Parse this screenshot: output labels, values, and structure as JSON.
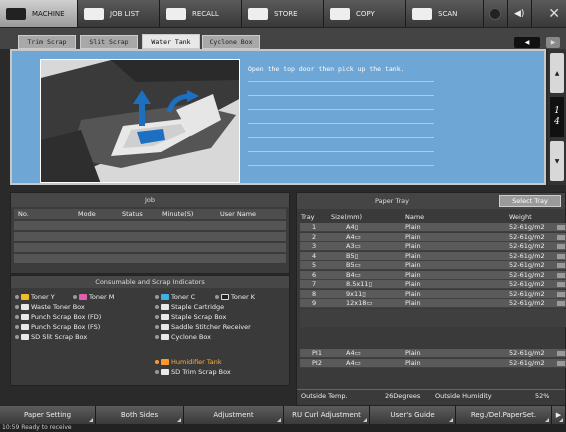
{
  "top_tabs": [
    {
      "label": "MACHINE",
      "icon": "machine-icon"
    },
    {
      "label": "JOB LIST",
      "icon": "job-list-icon"
    },
    {
      "label": "RECALL",
      "icon": "recall-icon"
    },
    {
      "label": "STORE",
      "icon": "store-icon"
    },
    {
      "label": "COPY",
      "icon": "copy-icon"
    },
    {
      "label": "SCAN",
      "icon": "scan-icon"
    }
  ],
  "sub_tabs": [
    "Trim Scrap",
    "Slit Scrap",
    "Water Tank",
    "Cyclone Box"
  ],
  "active_sub_tab": "Water Tank",
  "guide": {
    "instruction": "Open the top door then pick up the tank."
  },
  "page_indicator": {
    "current": "1",
    "total": "4"
  },
  "job": {
    "title": "Job",
    "columns": [
      "No.",
      "Mode",
      "Status",
      "Minute(S)",
      "User Name"
    ]
  },
  "consumables": {
    "title": "Consumable and Scrap Indicators",
    "left": [
      "Toner Y",
      "Toner M",
      "Waste Toner Box",
      "Punch Scrap Box (FD)",
      "Punch Scrap Box (FS)",
      "SD Slit Scrap Box"
    ],
    "right": [
      "Toner C",
      "Toner K",
      "Staple Cartridge",
      "Staple Scrap Box",
      "Saddle Stitcher Receiver",
      "Cyclone Box"
    ],
    "alert": "Humidifier Tank",
    "extra": "SD Trim Scrap Box"
  },
  "paper_tray": {
    "title": "Paper Tray",
    "select_button": "Select Tray",
    "columns": [
      "Tray",
      "Size(mm)",
      "Name",
      "Weight"
    ],
    "rows": [
      {
        "tray": "1",
        "size": "A4▯",
        "name": "Plain",
        "weight": "52-61g/m2"
      },
      {
        "tray": "2",
        "size": "A4▭",
        "name": "Plain",
        "weight": "52-61g/m2"
      },
      {
        "tray": "3",
        "size": "A3▭",
        "name": "Plain",
        "weight": "52-61g/m2"
      },
      {
        "tray": "4",
        "size": "B5▯",
        "name": "Plain",
        "weight": "52-61g/m2"
      },
      {
        "tray": "5",
        "size": "B5▭",
        "name": "Plain",
        "weight": "52-61g/m2"
      },
      {
        "tray": "6",
        "size": "B4▭",
        "name": "Plain",
        "weight": "52-61g/m2"
      },
      {
        "tray": "7",
        "size": "8.5x11▯",
        "name": "Plain",
        "weight": "52-61g/m2"
      },
      {
        "tray": "8",
        "size": "9x11▯",
        "name": "Plain",
        "weight": "52-61g/m2"
      },
      {
        "tray": "9",
        "size": "12x18▭",
        "name": "Plain",
        "weight": "52-61g/m2"
      }
    ],
    "pi_rows": [
      {
        "tray": "PI1",
        "size": "A4▭",
        "name": "Plain",
        "weight": "52-61g/m2"
      },
      {
        "tray": "PI2",
        "size": "A4▭",
        "name": "Plain",
        "weight": "52-61g/m2"
      }
    ],
    "outside_temp_label": "Outside Temp.",
    "outside_temp_value": "26Degrees",
    "outside_humidity_label": "Outside Humidity",
    "outside_humidity_value": "52%"
  },
  "bottom_buttons": [
    "Paper Setting",
    "Both Sides",
    "Adjustment",
    "RU Curl Adjustment",
    "User's Guide",
    "Reg./Del.PaperSet."
  ],
  "status": "10:59  Ready to receive"
}
